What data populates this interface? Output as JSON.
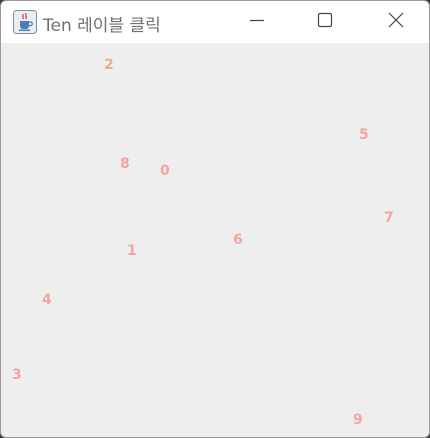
{
  "window": {
    "title": "Ten 레이블 클릭"
  },
  "titlebar_icons": {
    "app_icon": "java-coffee-icon",
    "minimize": "minimize-icon",
    "maximize": "maximize-icon",
    "close": "close-icon"
  },
  "labels": [
    "0",
    "1",
    "2",
    "3",
    "4",
    "5",
    "6",
    "7",
    "8",
    "9"
  ],
  "colors": {
    "label": "#f4a5a0",
    "background": "#eeeeee",
    "titlebar": "#ffffff"
  }
}
